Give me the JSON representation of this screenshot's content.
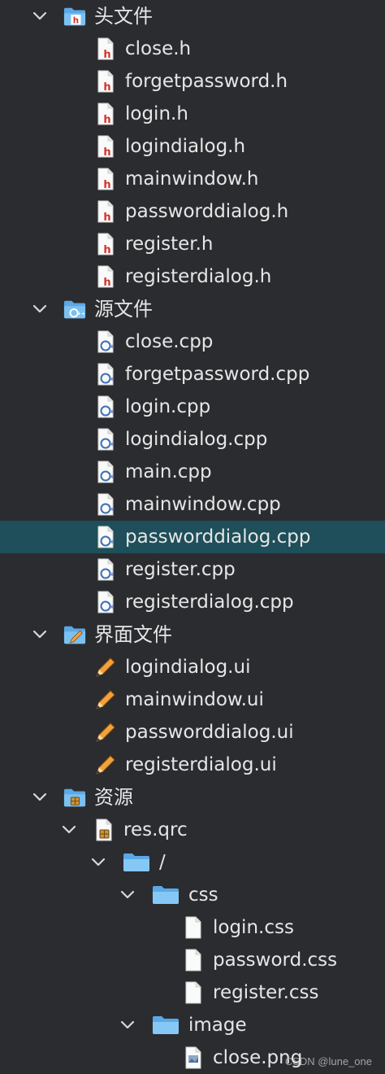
{
  "tree": {
    "headers_folder": {
      "label": "头文件",
      "items": [
        "close.h",
        "forgetpassword.h",
        "login.h",
        "logindialog.h",
        "mainwindow.h",
        "passworddialog.h",
        "register.h",
        "registerdialog.h"
      ]
    },
    "sources_folder": {
      "label": "源文件",
      "items": [
        "close.cpp",
        "forgetpassword.cpp",
        "login.cpp",
        "logindialog.cpp",
        "main.cpp",
        "mainwindow.cpp",
        "passworddialog.cpp",
        "register.cpp",
        "registerdialog.cpp"
      ],
      "selected": "passworddialog.cpp"
    },
    "forms_folder": {
      "label": "界面文件",
      "items": [
        "logindialog.ui",
        "mainwindow.ui",
        "passworddialog.ui",
        "registerdialog.ui"
      ]
    },
    "resources_folder": {
      "label": "资源",
      "qrc": "res.qrc",
      "prefix": "/",
      "css_folder": {
        "label": "css",
        "items": [
          "login.css",
          "password.css",
          "register.css"
        ]
      },
      "image_folder": {
        "label": "image",
        "items": [
          "close.png"
        ]
      }
    }
  },
  "watermark": "CSDN @lune_one",
  "colors": {
    "background": "#2b2c30",
    "selected_row": "#1e4f5a",
    "text": "#e6e6e6",
    "folder_blue": "#5aa9e6",
    "header_red": "#d0312d",
    "cpp_blue": "#3a6fb5"
  }
}
